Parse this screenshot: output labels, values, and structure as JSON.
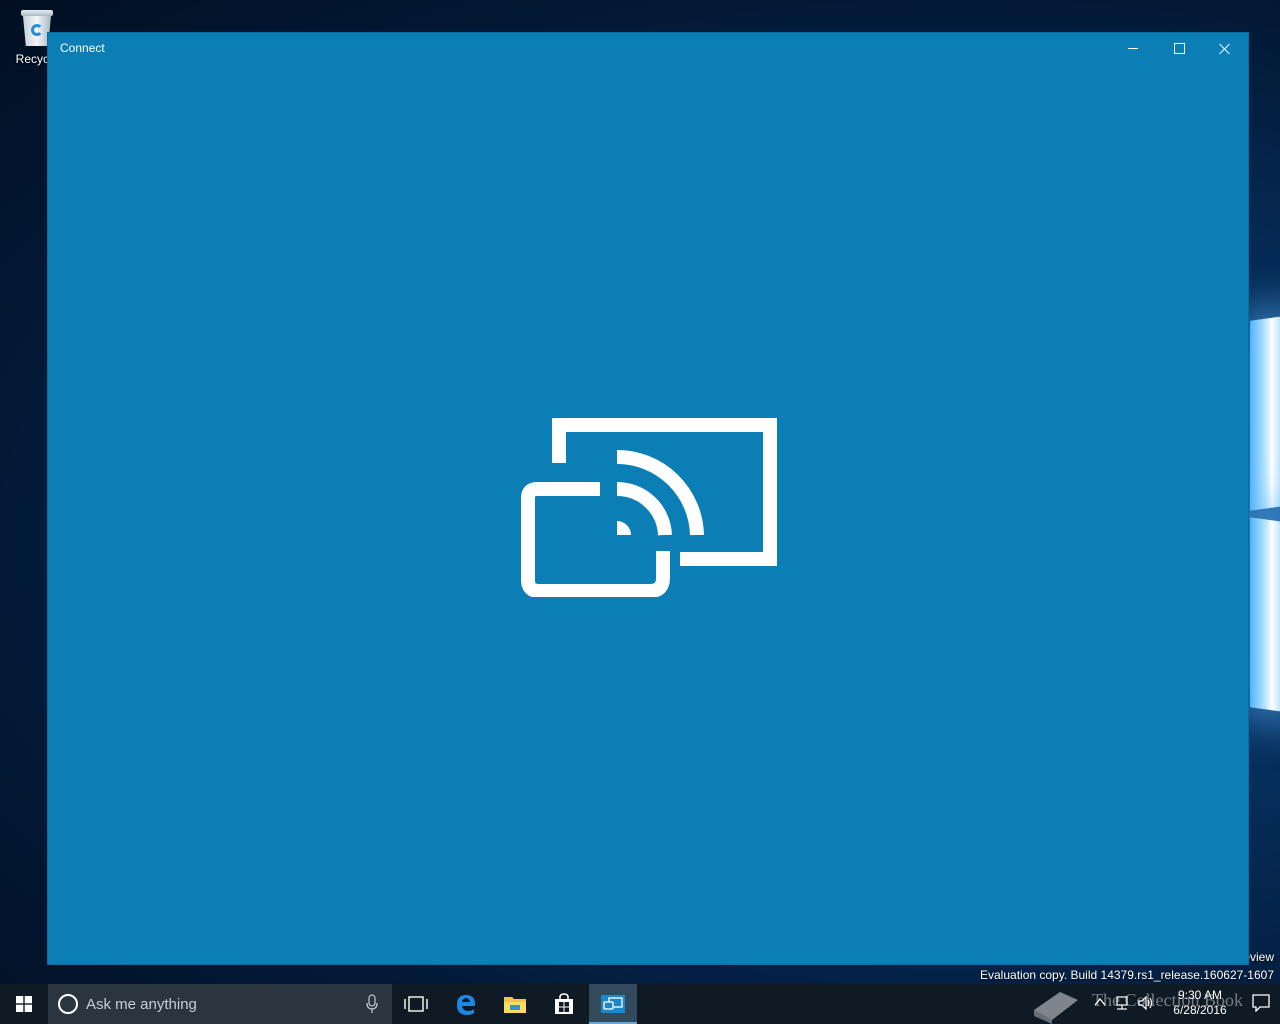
{
  "desktop": {
    "icons": [
      {
        "label": "Recycle"
      }
    ],
    "watermark": {
      "line1": "eview",
      "line2": "Evaluation copy. Build 14379.rs1_release.160627-1607"
    }
  },
  "window": {
    "title": "Connect",
    "background_color": "#0a7eb5",
    "logo_icon": "connect-cast-icon"
  },
  "taskbar": {
    "search": {
      "placeholder": "Ask me anything"
    },
    "pinned": [
      {
        "icon": "task-view-icon"
      },
      {
        "icon": "edge-icon"
      },
      {
        "icon": "file-explorer-icon"
      },
      {
        "icon": "store-icon"
      },
      {
        "icon": "connect-app-icon",
        "active": true
      }
    ],
    "tray": {
      "brand": "The Collection Book",
      "time": "9:30 AM",
      "date": "6/28/2016"
    }
  }
}
